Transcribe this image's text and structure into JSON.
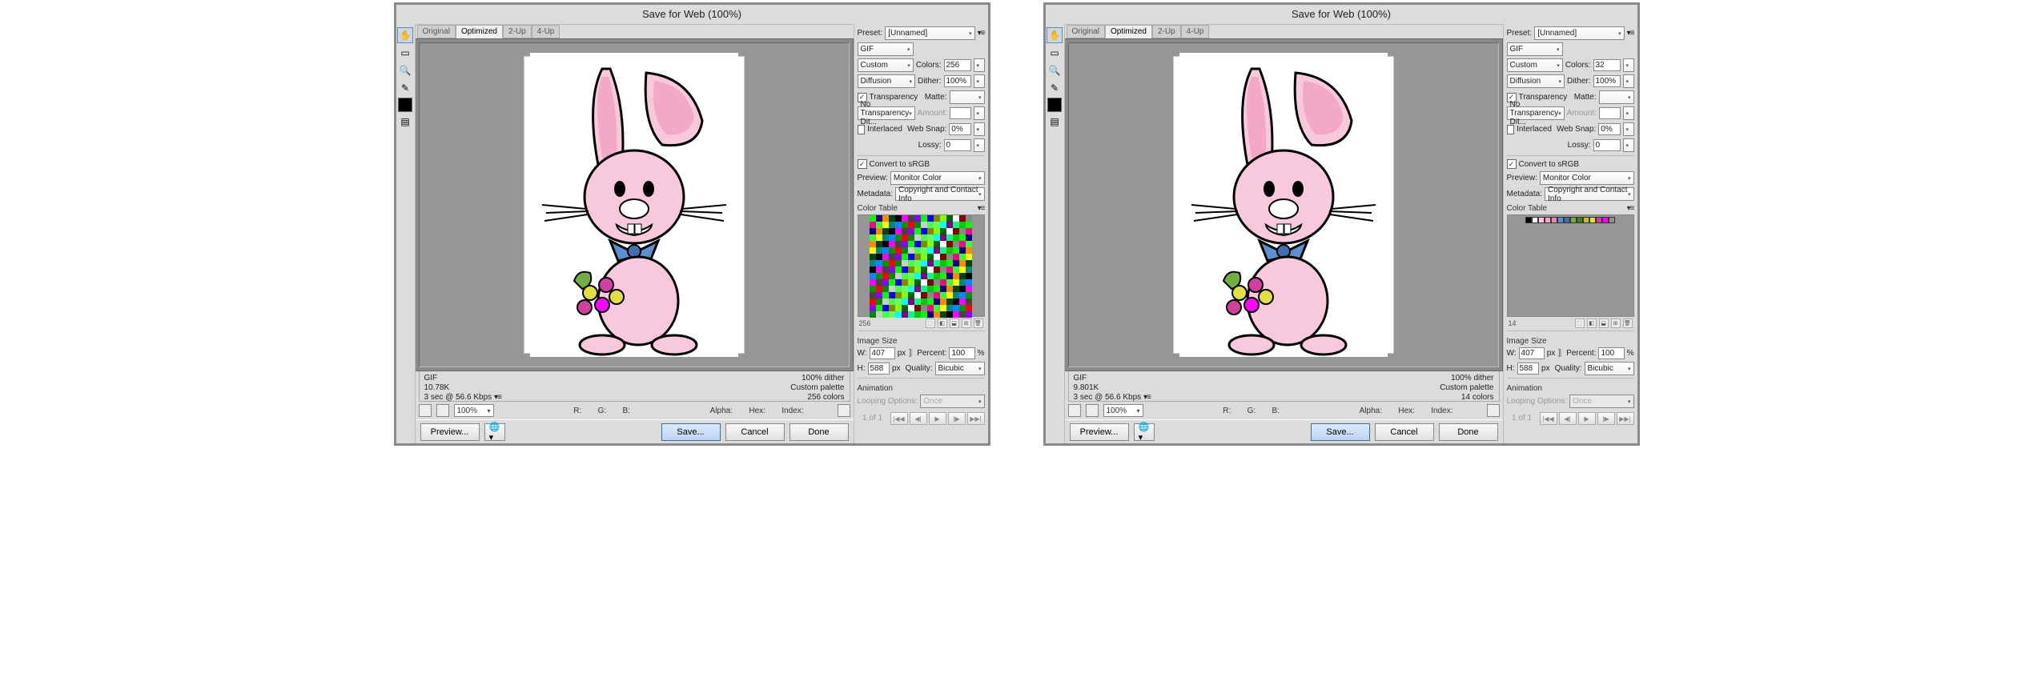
{
  "left": {
    "title": "Save for Web (100%)",
    "tabs": [
      "Original",
      "Optimized",
      "2-Up",
      "4-Up"
    ],
    "status": {
      "format": "GIF",
      "size": "10.78K",
      "time": "3 sec @ 56.6 Kbps",
      "dither": "100% dither",
      "palette": "Custom palette",
      "colors": "256 colors"
    },
    "zoom": "100%",
    "readout": {
      "r": "R:",
      "g": "G:",
      "b": "B:",
      "alpha": "Alpha:",
      "hex": "Hex:",
      "index": "Index:"
    },
    "panel": {
      "preset_label": "Preset:",
      "preset": "[Unnamed]",
      "format": "GIF",
      "reduction": "Custom",
      "colors_label": "Colors:",
      "colors": "256",
      "dither_algo": "Diffusion",
      "dither_label": "Dither:",
      "dither": "100%",
      "transparency": "Transparency",
      "matte_label": "Matte:",
      "trans_dither": "No Transparency Dit...",
      "amount_label": "Amount:",
      "interlaced": "Interlaced",
      "websnap_label": "Web Snap:",
      "websnap": "0%",
      "lossy_label": "Lossy:",
      "lossy": "0",
      "srgb": "Convert to sRGB",
      "preview_label": "Preview:",
      "preview": "Monitor Color",
      "metadata_label": "Metadata:",
      "metadata": "Copyright and Contact Info",
      "ct_label": "Color Table",
      "ct_count": "256",
      "is_label": "Image Size",
      "w_lbl": "W:",
      "w": "407",
      "h_lbl": "H:",
      "h": "588",
      "px": "px",
      "percent_lbl": "Percent:",
      "percent": "100",
      "pct": "%",
      "quality_lbl": "Quality:",
      "quality": "Bicubic",
      "anim_lbl": "Animation",
      "loop_lbl": "Looping Options:",
      "loop": "Once",
      "frame": "1 of 1"
    },
    "buttons": {
      "preview": "Preview...",
      "save": "Save...",
      "cancel": "Cancel",
      "done": "Done"
    }
  },
  "right": {
    "title": "Save for Web (100%)",
    "tabs": [
      "Original",
      "Optimized",
      "2-Up",
      "4-Up"
    ],
    "status": {
      "format": "GIF",
      "size": "9.801K",
      "time": "3 sec @ 56.6 Kbps",
      "dither": "100% dither",
      "palette": "Custom palette",
      "colors": "14 colors"
    },
    "zoom": "100%",
    "readout": {
      "r": "R:",
      "g": "G:",
      "b": "B:",
      "alpha": "Alpha:",
      "hex": "Hex:",
      "index": "Index:"
    },
    "panel": {
      "preset_label": "Preset:",
      "preset": "[Unnamed]",
      "format": "GIF",
      "reduction": "Custom",
      "colors_label": "Colors:",
      "colors": "32",
      "dither_algo": "Diffusion",
      "dither_label": "Dither:",
      "dither": "100%",
      "transparency": "Transparency",
      "matte_label": "Matte:",
      "trans_dither": "No Transparency Dit...",
      "amount_label": "Amount:",
      "interlaced": "Interlaced",
      "websnap_label": "Web Snap:",
      "websnap": "0%",
      "lossy_label": "Lossy:",
      "lossy": "0",
      "srgb": "Convert to sRGB",
      "preview_label": "Preview:",
      "preview": "Monitor Color",
      "metadata_label": "Metadata:",
      "metadata": "Copyright and Contact Info",
      "ct_label": "Color Table",
      "ct_count": "14",
      "is_label": "Image Size",
      "w_lbl": "W:",
      "w": "407",
      "h_lbl": "H:",
      "h": "588",
      "px": "px",
      "percent_lbl": "Percent:",
      "percent": "100",
      "pct": "%",
      "quality_lbl": "Quality:",
      "quality": "Bicubic",
      "anim_lbl": "Animation",
      "loop_lbl": "Looping Options:",
      "loop": "Once",
      "frame": "1 of 1"
    },
    "buttons": {
      "preview": "Preview...",
      "save": "Save...",
      "cancel": "Cancel",
      "done": "Done"
    }
  },
  "ct_colors_14": [
    "#000000",
    "#ffffff",
    "#f8c8dc",
    "#f4a8c8",
    "#e888b0",
    "#5a8fd0",
    "#4070b0",
    "#70b040",
    "#408020",
    "#c0c020",
    "#e0e040",
    "#d040a0",
    "#ff00ff",
    "#909090"
  ]
}
